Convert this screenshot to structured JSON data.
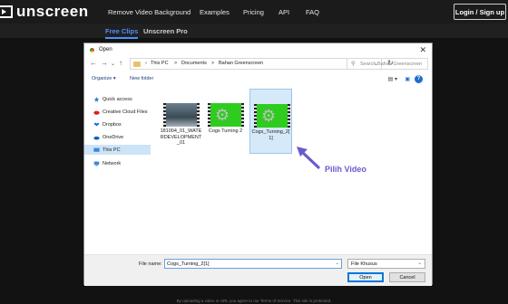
{
  "site": {
    "logo_text": "unscreen",
    "nav": [
      "Remove Video Background",
      "Examples",
      "Pricing",
      "API",
      "FAQ"
    ],
    "login_label": "Login / Sign up",
    "subtabs": [
      "Free Clips",
      "Unscreen Pro"
    ]
  },
  "dialog": {
    "title": "Open",
    "breadcrumb": [
      "This PC",
      ">",
      "Documents",
      ">",
      "Bahan Greenscreen"
    ],
    "search_placeholder": "Search Bahan Greenscreen",
    "toolbar": {
      "organize": "Organize ▾",
      "new_folder": "New folder"
    },
    "sidebar": [
      {
        "label": "Quick access",
        "icon": "star-icon",
        "color": "#2b7cd3"
      },
      {
        "label": "Creative Cloud Files",
        "icon": "cloud-icon",
        "color": "#da1f26"
      },
      {
        "label": "Dropbox",
        "icon": "dropbox-icon",
        "color": "#0061fe"
      },
      {
        "label": "OneDrive",
        "icon": "onedrive-icon",
        "color": "#0364b8"
      },
      {
        "label": "This PC",
        "icon": "pc-icon",
        "color": "#3c8ad8"
      },
      {
        "label": "Network",
        "icon": "network-icon",
        "color": "#3c8ad8"
      }
    ],
    "files": [
      {
        "name": "181004_01_WATE RDEVELOPMENT _01",
        "type": "water"
      },
      {
        "name": "Cogs Turning 2",
        "type": "green"
      },
      {
        "name": "Cogs_Turning_2[ 1]",
        "type": "green"
      }
    ],
    "annotation": "Pilih Video",
    "filename_label": "File name:",
    "filename_value": "Cogs_Turning_2[1]",
    "filter_value": "File Khusus",
    "open_label": "Open",
    "cancel_label": "Cancel"
  },
  "footer_note": "By uploading a video or URL you agree to our Terms of Service. This site is protected."
}
